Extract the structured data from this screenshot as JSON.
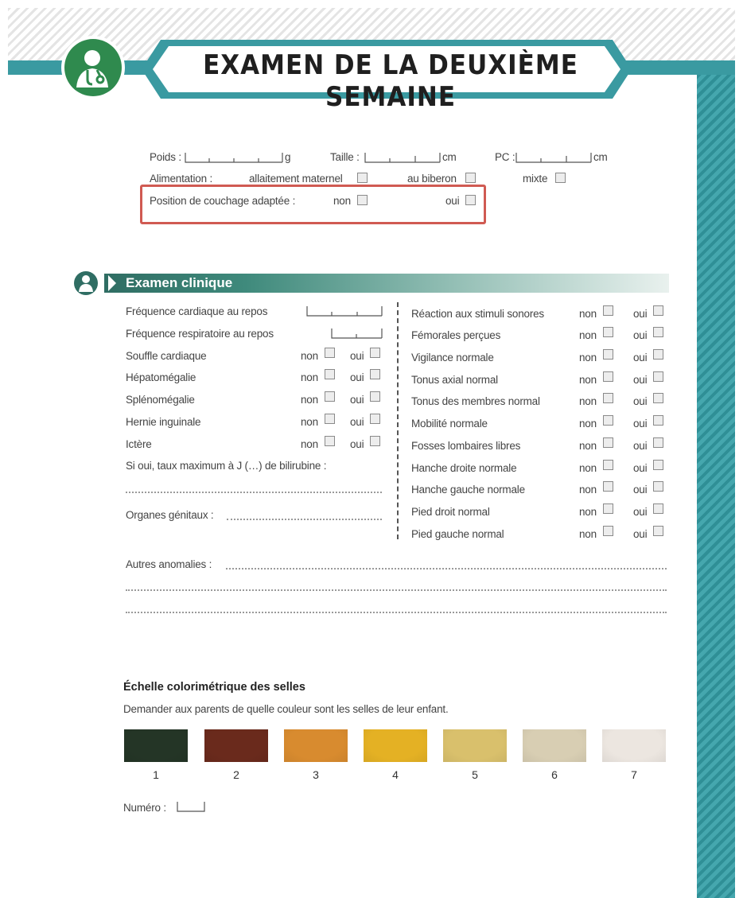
{
  "header": {
    "title": "EXAMEN DE LA DEUXIÈME SEMAINE"
  },
  "measures": {
    "poids_label": "Poids :",
    "poids_unit": "g",
    "taille_label": "Taille :",
    "taille_unit": "cm",
    "pc_label": "PC :",
    "pc_unit": "cm",
    "alimentation_label": "Alimentation :",
    "alimentation_options": [
      "allaitement maternel",
      "au biberon",
      "mixte"
    ],
    "couchage_label": "Position de couchage adaptée :",
    "non": "non",
    "oui": "oui"
  },
  "clinical": {
    "section_title": "Examen clinique",
    "left_rows": [
      "Fréquence cardiaque au repos",
      "Fréquence respiratoire au repos",
      "Souffle cardiaque",
      "Hépatomégalie",
      "Splénomégalie",
      "Hernie inguinale",
      "Ictère"
    ],
    "bilirubine_label": "Si oui, taux maximum à J (…) de bilirubine :",
    "organes_label": "Organes génitaux :",
    "right_rows": [
      "Réaction aux stimuli sonores",
      "Fémorales perçues",
      "Vigilance normale",
      "Tonus axial normal",
      "Tonus des membres normal",
      "Mobilité normale",
      "Fosses lombaires libres",
      "Hanche droite normale",
      "Hanche gauche normale",
      "Pied droit normal",
      "Pied gauche normal"
    ],
    "autres_label": "Autres anomalies :",
    "non": "non",
    "oui": "oui"
  },
  "stool_scale": {
    "title": "Échelle colorimétrique des selles",
    "subtitle": "Demander aux parents de quelle couleur sont les selles de leur enfant.",
    "swatches": [
      {
        "number": "1",
        "color": "#243526"
      },
      {
        "number": "2",
        "color": "#6a2a1c"
      },
      {
        "number": "3",
        "color": "#d88b2f"
      },
      {
        "number": "4",
        "color": "#e4b124"
      },
      {
        "number": "5",
        "color": "#d9c06c"
      },
      {
        "number": "6",
        "color": "#d8ceb3"
      },
      {
        "number": "7",
        "color": "#ece6e0"
      }
    ],
    "numero_label": "Numéro :"
  },
  "colors": {
    "teal": "#3a9aa1",
    "section_green": "#2f6d63",
    "highlight_red": "#d05a52",
    "logo_green": "#2f8a4e"
  }
}
